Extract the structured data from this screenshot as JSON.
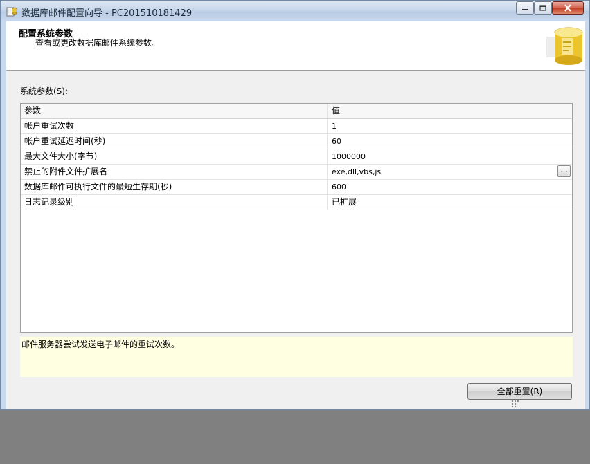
{
  "window": {
    "title": "数据库邮件配置向导 - PC201510181429"
  },
  "header": {
    "title": "配置系统参数",
    "subtitle": "查看或更改数据库邮件系统参数。"
  },
  "system_params": {
    "label": "系统参数(S):",
    "columns": {
      "name": "参数",
      "value": "值"
    },
    "rows": [
      {
        "name": "帐户重试次数",
        "value": "1"
      },
      {
        "name": "帐户重试延迟时间(秒)",
        "value": "60"
      },
      {
        "name": "最大文件大小(字节)",
        "value": "1000000"
      },
      {
        "name": "禁止的附件文件扩展名",
        "value": "exe,dll,vbs,js",
        "ellipsis": "..."
      },
      {
        "name": "数据库邮件可执行文件的最短生存期(秒)",
        "value": "600"
      },
      {
        "name": "日志记录级别",
        "value": "已扩展"
      }
    ]
  },
  "description": "邮件服务器尝试发送电子邮件的重试次数。",
  "buttons": {
    "reset_all": "全部重置(R)"
  },
  "icons": {
    "app": "wizard-app-icon",
    "header": "database-cylinder-icon"
  }
}
